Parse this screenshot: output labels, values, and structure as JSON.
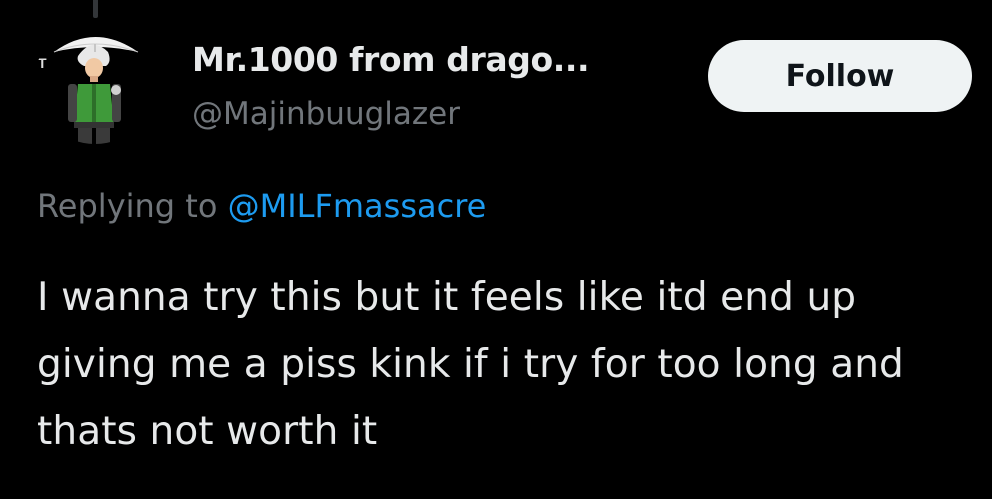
{
  "tweet": {
    "author": {
      "display_name": "Mr.1000 from drago...",
      "handle": "@Majinbuuglazer",
      "avatar_icon": "anime-character-avatar"
    },
    "follow_label": "Follow",
    "replying_prefix": "Replying to",
    "replying_to": "@MILFmassacre",
    "text": "I wanna try this but it feels like itd end up giving me a piss kink if i try for too long and thats not worth it"
  },
  "colors": {
    "background": "#000000",
    "text_primary": "#e7e9ea",
    "text_secondary": "#71767b",
    "link": "#1d9bf0",
    "follow_bg": "#eff3f4",
    "follow_text": "#0f1419"
  }
}
